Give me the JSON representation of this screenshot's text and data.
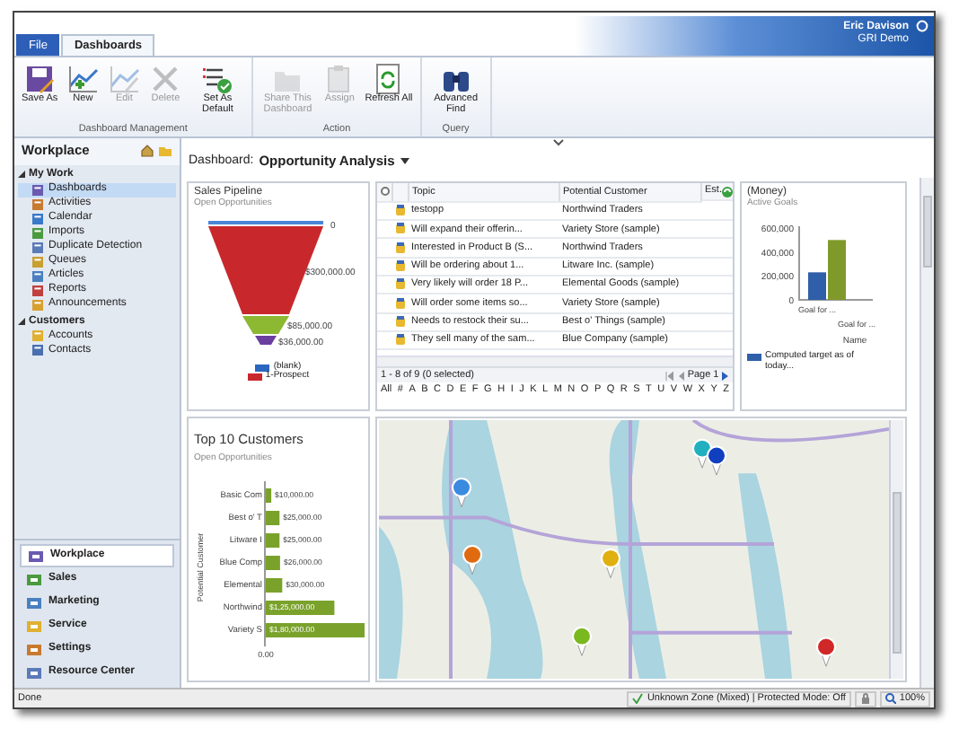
{
  "tabs": [
    {
      "label": "File",
      "kind": "file",
      "selected": false
    },
    {
      "label": "Dashboards",
      "kind": "tab",
      "selected": true
    }
  ],
  "user": {
    "name": "Eric Davison",
    "organization": "GRI Demo"
  },
  "ribbon": {
    "groups": [
      {
        "label": "Dashboard Management",
        "buttons": [
          {
            "label": "Save As",
            "disabled": false
          },
          {
            "label": "New",
            "disabled": false
          },
          {
            "label": "Edit",
            "disabled": true
          },
          {
            "label": "Delete",
            "disabled": true
          },
          {
            "label": "Set As Default",
            "disabled": false
          }
        ]
      },
      {
        "label": "Action",
        "buttons": [
          {
            "label": "Share This Dashboard",
            "disabled": true
          },
          {
            "label": "Assign",
            "disabled": true
          },
          {
            "label": "Refresh All",
            "disabled": false
          }
        ]
      },
      {
        "label": "Query",
        "buttons": [
          {
            "label": "Advanced Find",
            "disabled": false
          }
        ]
      }
    ]
  },
  "nav": {
    "title": "Workplace",
    "groups": [
      {
        "label": "My Work",
        "expanded": true,
        "items": [
          {
            "label": "Dashboards",
            "selected": true
          },
          {
            "label": "Activities",
            "selected": false
          },
          {
            "label": "Calendar",
            "selected": false
          },
          {
            "label": "Imports",
            "selected": false
          },
          {
            "label": "Duplicate Detection",
            "selected": false
          },
          {
            "label": "Queues",
            "selected": false
          },
          {
            "label": "Articles",
            "selected": false
          },
          {
            "label": "Reports",
            "selected": false
          },
          {
            "label": "Announcements",
            "selected": false
          }
        ]
      },
      {
        "label": "Customers",
        "expanded": true,
        "items": [
          {
            "label": "Accounts",
            "selected": false
          },
          {
            "label": "Contacts",
            "selected": false
          }
        ]
      }
    ],
    "areas": [
      {
        "label": "Workplace",
        "selected": true
      },
      {
        "label": "Sales",
        "selected": false
      },
      {
        "label": "Marketing",
        "selected": false
      },
      {
        "label": "Service",
        "selected": false
      },
      {
        "label": "Settings",
        "selected": false
      },
      {
        "label": "Resource Center",
        "selected": false
      }
    ]
  },
  "dashboard": {
    "label": "Dashboard:",
    "name": "Opportunity Analysis"
  },
  "sales_pipeline": {
    "title": "Sales Pipeline",
    "subtitle": "Open Opportunities",
    "segments": [
      {
        "label": "0",
        "color": "#4a86d8"
      },
      {
        "label": "$300,000.00",
        "color": "#c8282c"
      },
      {
        "label": "$85,000.00",
        "color": "#8cb832"
      },
      {
        "label": "$36,000.00",
        "color": "#6a3fa0"
      }
    ],
    "legend": [
      {
        "label": "(blank)",
        "color": "#2a66c0"
      },
      {
        "label": "1-Prospect",
        "color": "#c8282c"
      }
    ]
  },
  "opportunities": {
    "columns": [
      "Topic",
      "Potential Customer",
      "Est."
    ],
    "select_all_checked": false,
    "rows": [
      {
        "topic": "testopp",
        "customer": "Northwind Traders"
      },
      {
        "topic": "Will expand their offerin...",
        "customer": "Variety Store (sample)"
      },
      {
        "topic": "Interested in Product B (S...",
        "customer": "Northwind Traders"
      },
      {
        "topic": "Will be ordering about 1...",
        "customer": "Litware Inc. (sample)"
      },
      {
        "topic": "Very likely will order 18 P...",
        "customer": "Elemental Goods (sample)"
      },
      {
        "topic": "Will order some items so...",
        "customer": "Variety Store (sample)"
      },
      {
        "topic": "Needs to restock their su...",
        "customer": "Best o' Things (sample)"
      },
      {
        "topic": "They sell many of the sam...",
        "customer": "Blue Company (sample)"
      }
    ],
    "record_count": "1 - 8 of 9 (0 selected)",
    "page": "Page 1",
    "index": [
      "All",
      "#",
      "A",
      "B",
      "C",
      "D",
      "E",
      "F",
      "G",
      "H",
      "I",
      "J",
      "K",
      "L",
      "M",
      "N",
      "O",
      "P",
      "Q",
      "R",
      "S",
      "T",
      "U",
      "V",
      "W",
      "X",
      "Y",
      "Z"
    ]
  },
  "goals": {
    "title": "(Money)",
    "subtitle": "Active Goals",
    "chart_data": {
      "type": "bar",
      "xlabel": "Name",
      "categories": [
        "Goal for ...",
        "Goal for ..."
      ],
      "series": [
        {
          "name": "Computed target as of today...",
          "color": "#2f5fa8",
          "values": [
            230000,
            null
          ]
        },
        {
          "color": "#7f9a2a",
          "values": [
            null,
            500000
          ]
        }
      ],
      "ylim": [
        0,
        600000
      ],
      "yticks": [
        {
          "value": 0,
          "label": "0"
        },
        {
          "value": 200000,
          "label": "200,000"
        },
        {
          "value": 400000,
          "label": "400,000"
        },
        {
          "value": 600000,
          "label": "600,000"
        }
      ]
    }
  },
  "top_customers": {
    "title": "Top 10 Customers",
    "subtitle": "Open Opportunities",
    "chart_data": {
      "type": "bar",
      "orientation": "horizontal",
      "ylabel": "Potential Customer",
      "categories": [
        "Basic Com",
        "Best o' T",
        "Litware I",
        "Blue Comp",
        "Elemental",
        "Northwind",
        "Variety S"
      ],
      "values": [
        10000,
        25000,
        25000,
        26000,
        30000,
        125000,
        180000
      ],
      "value_labels": [
        "$10,000.00",
        "$25,000.00",
        "$25,000.00",
        "$26,000.00",
        "$30,000.00",
        "$1,25,000.00",
        "$1,80,000.00"
      ]
    },
    "axis_origin_label": "0.00"
  },
  "status_bar": {
    "text": "Done",
    "zone": "Unknown Zone (Mixed) | Protected Mode: Off",
    "zoom": "100%"
  }
}
